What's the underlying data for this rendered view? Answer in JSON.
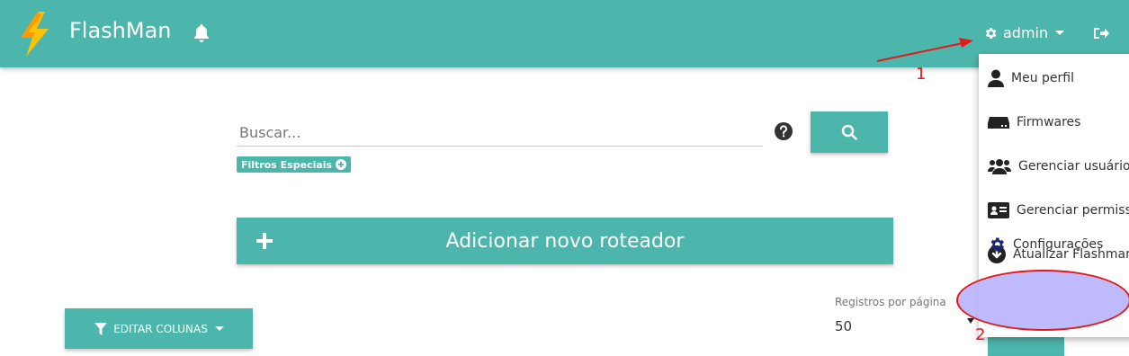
{
  "app": {
    "title": "FlashMan"
  },
  "header": {
    "user_label": "admin"
  },
  "search": {
    "placeholder": "Buscar...",
    "filters_label": "Filtros Especiais"
  },
  "main": {
    "add_label": "Adicionar novo roteador",
    "edit_columns_label": "EDITAR COLUNAS"
  },
  "pagination": {
    "label": "Registros por página",
    "value": "50"
  },
  "user_menu": {
    "items": [
      {
        "label": "Meu perfil",
        "icon": "user-icon"
      },
      {
        "label": "Firmwares",
        "icon": "hdd-icon"
      },
      {
        "label": "Gerenciar usuários",
        "icon": "users-icon"
      },
      {
        "label": "Gerenciar permissões",
        "icon": "id-card-icon"
      },
      {
        "label": "Atualizar Flashman",
        "icon": "download-icon"
      },
      {
        "label": "Configurações",
        "icon": "gear-icon"
      }
    ]
  },
  "annotations": {
    "step1": "1",
    "step2": "2"
  },
  "colors": {
    "teal": "#4db6ac",
    "annotation_red": "#e3191c",
    "highlight": "#b8b2fa"
  }
}
